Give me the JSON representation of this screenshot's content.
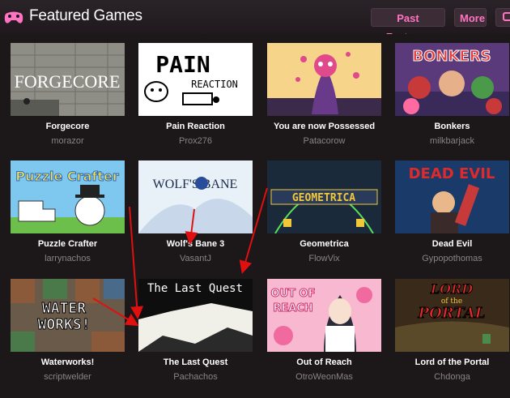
{
  "header": {
    "title": "Featured Games",
    "past_features_label": "Past Features",
    "more_label": "More",
    "accent_color": "#ff73c3"
  },
  "thumb_text": {
    "forgecore": "FORGECORE",
    "pain_1": "PAIN",
    "pain_2": "REACTION",
    "bonkers": "BONKERS",
    "puzzle": "Puzzle Crafter",
    "wolf": "WOLF'S BANE",
    "geometrica": "GEOMETRICA",
    "dead_evil": "DEAD EVIL",
    "water_1": "WATER",
    "water_2": "WORKS!",
    "last_quest": "The Last Quest",
    "out_1": "OUT OF",
    "out_2": "REACH",
    "lord_1": "LORD",
    "lord_2": "of the",
    "lord_3": "PORTAL"
  },
  "games": [
    {
      "title": "Forgecore",
      "author": "morazor"
    },
    {
      "title": "Pain Reaction",
      "author": "Prox276"
    },
    {
      "title": "You are now Possessed",
      "author": "Patacorow"
    },
    {
      "title": "Bonkers",
      "author": "milkbarjack"
    },
    {
      "title": "Puzzle Crafter",
      "author": "larrynachos"
    },
    {
      "title": "Wolf's Bane 3",
      "author": "VasantJ"
    },
    {
      "title": "Geometrica",
      "author": "FlowVix"
    },
    {
      "title": "Dead Evil",
      "author": "Gypopothomas"
    },
    {
      "title": "Waterworks!",
      "author": "scriptwelder"
    },
    {
      "title": "The Last Quest",
      "author": "Pachachos"
    },
    {
      "title": "Out of Reach",
      "author": "OtroWeonMas"
    },
    {
      "title": "Lord of the Portal",
      "author": "Chdonga"
    }
  ]
}
